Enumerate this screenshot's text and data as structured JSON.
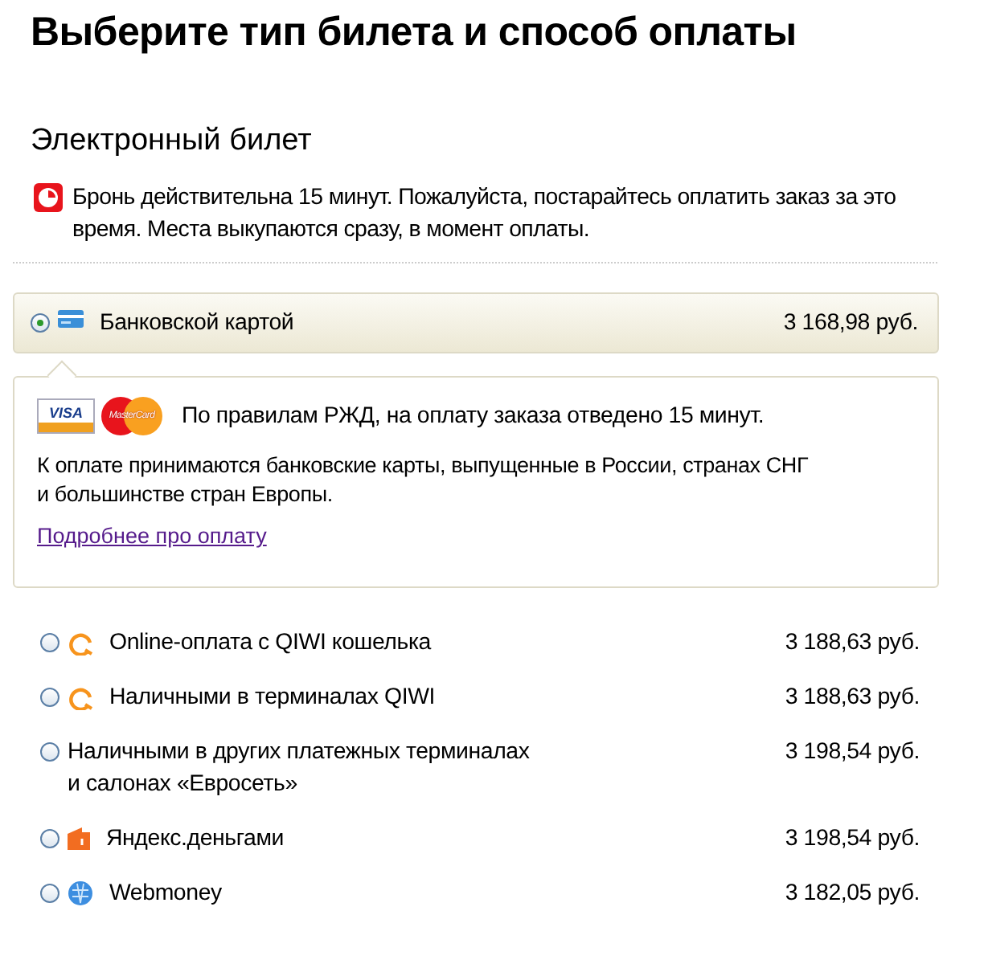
{
  "title": "Выберите тип билета и способ оплаты",
  "section": "Электронный билет",
  "notice": "Бронь действительна 15 минут. Пожалуйста, постарайтесь оплатить заказ за это время. Места выкупаются сразу, в момент оплаты.",
  "options": [
    {
      "label": "Банковской картой",
      "price": "3 168,98 руб.",
      "kind": "card",
      "selected": true
    },
    {
      "label": "Online-оплата с QIWI кошелька",
      "price": "3 188,63 руб.",
      "kind": "qiwi",
      "selected": false
    },
    {
      "label": "Наличными в терминалах QIWI",
      "price": "3 188,63 руб.",
      "kind": "qiwi",
      "selected": false
    },
    {
      "label": "Наличными в других платежных терминалах\nи салонах «Евросеть»",
      "price": "3 198,54 руб.",
      "kind": "plain",
      "selected": false
    },
    {
      "label": "Яндекс.деньгами",
      "price": "3 198,54 руб.",
      "kind": "yandex",
      "selected": false
    },
    {
      "label": "Webmoney",
      "price": "3 182,05 руб.",
      "kind": "webmoney",
      "selected": false
    }
  ],
  "details": {
    "visa_logo": "VISA",
    "mastercard_logo": "MasterCard",
    "rule": "По правилам РЖД, на оплату заказа отведено 15 минут.",
    "text": "К оплате принимаются банковские карты, выпущенные в России, странах СНГ\nи большинстве стран Европы.",
    "link": "Подробнее про оплату"
  }
}
